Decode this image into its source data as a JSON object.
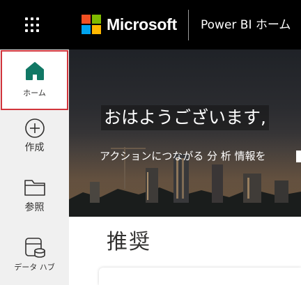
{
  "header": {
    "brand": "Microsoft",
    "product": "Power BI ホーム",
    "logo_colors": [
      "#f25022",
      "#7fba00",
      "#00a4ef",
      "#ffb900"
    ],
    "background": "#000000"
  },
  "nav": {
    "active_border_color": "#d1343b",
    "items": [
      {
        "label": "ホーム",
        "icon": "home-icon",
        "active": true,
        "color": "#117865"
      },
      {
        "label": "作成",
        "icon": "create-plus-icon"
      },
      {
        "label": "参照",
        "icon": "browse-folder-icon"
      },
      {
        "label": "データ ハブ",
        "icon": "data-hub-icon"
      }
    ]
  },
  "hero": {
    "greeting": "おはようございます,",
    "subtitle": "アクションにつながる 分 析 情報を"
  },
  "main": {
    "section_title": "推奨"
  }
}
